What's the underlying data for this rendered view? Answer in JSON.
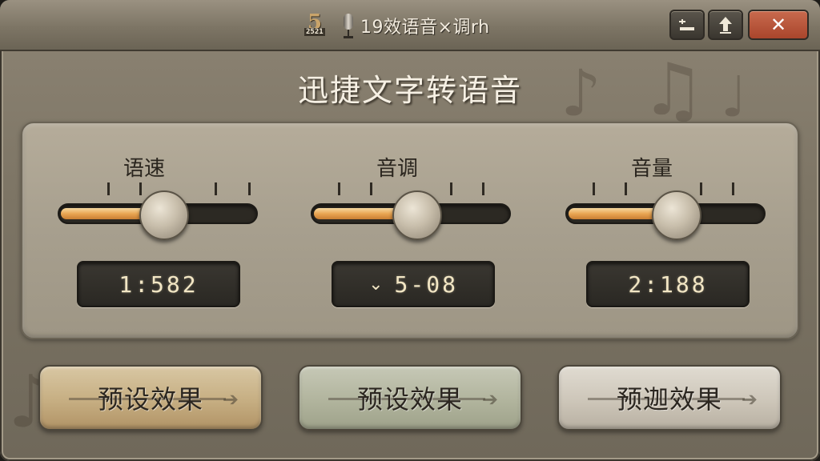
{
  "window": {
    "title": "19效语音×调rh",
    "logo_text": "5",
    "logo_subtext": "2521",
    "controls": {
      "minimize_icon": "minimize-icon",
      "restore_icon": "up-arrow-icon",
      "close_icon": "close-icon",
      "close_label": "✕"
    }
  },
  "heading": "迅捷文字转语音",
  "sliders": [
    {
      "label": "语速",
      "value_text": "1:582",
      "fill_fraction": 0.48,
      "has_dropdown": false
    },
    {
      "label": "音调",
      "value_text": "5-08",
      "fill_fraction": 0.48,
      "has_dropdown": true
    },
    {
      "label": "音量",
      "value_text": "2:188",
      "fill_fraction": 0.55,
      "has_dropdown": false
    }
  ],
  "dropdown_icon": "chevron-down-icon",
  "presets": [
    {
      "label": "预设效果"
    },
    {
      "label": "预设效果"
    },
    {
      "label": "预迦效果"
    }
  ],
  "colors": {
    "accent_fill": "#e9a653",
    "close_button": "#a9452c",
    "readout_text": "#f2e6c4"
  }
}
